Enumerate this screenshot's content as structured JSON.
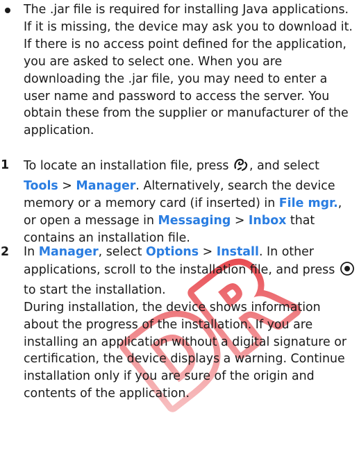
{
  "watermark": {
    "text": "DRAFT",
    "color": "#e3272f"
  },
  "bullet": {
    "icon": "bullet-dot",
    "text": "The .jar file is required for installing Java applications. If it is missing, the device may ask you to download it. If there is no access point defined for the application, you are asked to select one. When you are downloading the .jar file, you may need to enter a user name and password to access the server. You obtain these from the supplier or manufacturer of the application."
  },
  "step1": {
    "number": "1",
    "t1": "To locate an installation file, press",
    "menu_key_icon": "menu-key-icon",
    "t2": ", and select",
    "tools": "Tools",
    "sep1": ">",
    "manager": "Manager",
    "t3": ". Alternatively, search the device memory or a memory card (if inserted) in",
    "file_mgr": "File mgr.",
    "t4": ", or open a message in",
    "messaging": "Messaging",
    "sep2": ">",
    "inbox": "Inbox",
    "t5": "that contains an installation file."
  },
  "step2": {
    "number": "2",
    "t1": "In",
    "manager": "Manager",
    "t2": ", select",
    "options": "Options",
    "sep": ">",
    "install": "Install",
    "t3": ". In other applications, scroll to the installation file, and press",
    "select_key_icon": "select-key-icon",
    "t4": "to start the installation.",
    "para2": "During installation, the device shows information about the progress of the installation. If you are installing an application without a digital signature or certification, the device displays a warning. Continue installation only if you are sure of the origin and contents of the application."
  },
  "colors": {
    "link": "#2a7de1",
    "text": "#1a1a1a"
  }
}
